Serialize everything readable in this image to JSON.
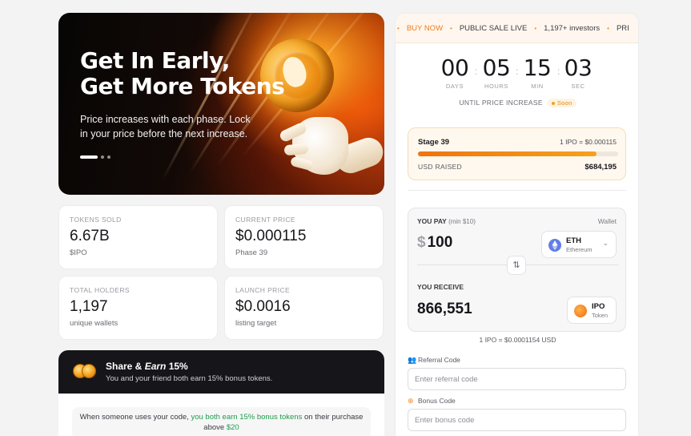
{
  "hero": {
    "title_line1": "Get In Early,",
    "title_line2": "Get More Tokens",
    "subtitle": "Price increases with each phase. Lock in your price before the next increase."
  },
  "stats": [
    {
      "label": "TOKENS SOLD",
      "value": "6.67B",
      "sub": "$IPO"
    },
    {
      "label": "CURRENT PRICE",
      "value": "$0.000115",
      "sub": "Phase 39"
    },
    {
      "label": "TOTAL HOLDERS",
      "value": "1,197",
      "sub": "unique wallets"
    },
    {
      "label": "LAUNCH PRICE",
      "value": "$0.0016",
      "sub": "listing target"
    }
  ],
  "share": {
    "title_prefix": "Share & ",
    "title_em": "Earn",
    "title_suffix": " 15%",
    "desc": "You and your friend both earn 15% bonus tokens.",
    "box_prefix": "When someone uses your code, ",
    "box_green": "you both earn 15% bonus tokens",
    "box_mid": " on their purchase above ",
    "box_amount": "$20"
  },
  "ticker": {
    "buy": "BUY NOW",
    "sale": "PUBLIC SALE LIVE",
    "investors": "1,197+ investors",
    "tail": "PRI"
  },
  "countdown": {
    "days": "00",
    "hours": "05",
    "min": "15",
    "sec": "03",
    "days_label": "DAYS",
    "hours_label": "HOURS",
    "min_label": "MIN",
    "sec_label": "SEC",
    "until": "UNTIL PRICE INCREASE",
    "soon": "Soon"
  },
  "stage": {
    "name": "Stage 39",
    "rate": "1 IPO = $0.000115",
    "progress": 0.89,
    "raised_label": "USD RAISED",
    "raised_value": "$684,195"
  },
  "swap": {
    "pay_label": "YOU PAY",
    "pay_min": "(min $10)",
    "wallet": "Wallet",
    "currency_symbol": "$",
    "pay_amount": "100",
    "pay_token_symbol": "ETH",
    "pay_token_name": "Ethereum",
    "receive_label": "YOU RECEIVE",
    "receive_amount": "866,551",
    "receive_token_symbol": "IPO",
    "receive_token_name": "Token"
  },
  "rate_note": "1 IPO = $0.0001154 USD",
  "referral": {
    "label": "Referral Code",
    "placeholder": "Enter referral code"
  },
  "bonus": {
    "label": "Bonus Code",
    "placeholder": "Enter bonus code"
  },
  "colors": {
    "accent": "#f08a2b",
    "green": "#1f9d4c",
    "eth": "#627eea"
  }
}
